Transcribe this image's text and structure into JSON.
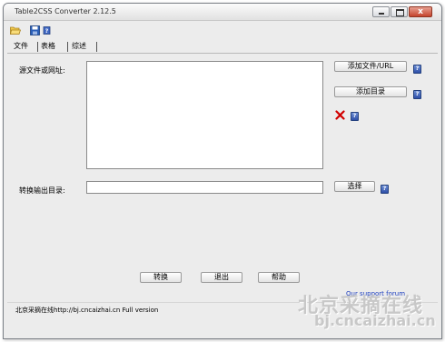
{
  "window": {
    "title": "Table2CSS Converter 2.12.5",
    "minimize_icon": "minimize-icon",
    "maximize_icon": "maximize-icon",
    "close_icon": "close-icon",
    "close_glyph": "x"
  },
  "toolbar": {
    "icons": [
      "folder-open-icon",
      "save-icon",
      "help-icon"
    ]
  },
  "tabs": [
    {
      "label": "文件",
      "active": true
    },
    {
      "label": "表格",
      "active": false
    },
    {
      "label": "综述",
      "active": false
    }
  ],
  "form": {
    "file_label": "源文件或网址:",
    "file_value": "",
    "add_file_button": "添加文件/URL",
    "add_dir_button": "添加目录",
    "delete_icon": "red-x-icon",
    "output_label": "转换输出目录:",
    "output_value": "",
    "choose_button": "选择",
    "help_glyph": "?"
  },
  "actions": {
    "convert": "转换",
    "exit": "退出",
    "help": "帮助"
  },
  "footer": {
    "support_link": "Our support forum",
    "status_text": "北京采摘在线http://bj.cncaizhai.cn  Full version"
  },
  "watermark": {
    "chinese": "北京采摘在线",
    "url": "bj.cncaizhai.cn"
  },
  "colors": {
    "window_bg": "#ececec",
    "link": "#1d3fbf",
    "help_icon": "#2e4fa8",
    "close_button": "#c5432c",
    "delete_icon": "#d10000"
  }
}
